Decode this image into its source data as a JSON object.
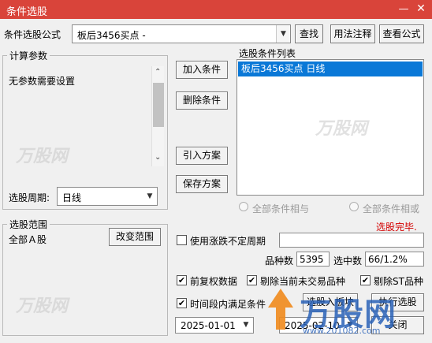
{
  "window": {
    "title": "条件选股"
  },
  "header": {
    "formula_label": "条件选股公式",
    "formula_value": "板后3456买点  -",
    "find_button": "查找",
    "usage_button": "用法注释",
    "view_formula_button": "查看公式"
  },
  "params": {
    "group_label": "计算参数",
    "no_params_text": "无参数需要设置",
    "period_label": "选股周期:",
    "period_value": "日线"
  },
  "actions": {
    "add_condition": "加入条件",
    "delete_condition": "删除条件",
    "import_scheme": "引入方案",
    "save_scheme": "保存方案"
  },
  "conditions": {
    "label": "选股条件列表",
    "items": [
      "板后3456买点  日线"
    ]
  },
  "logic": {
    "all_and": "全部条件相与",
    "all_or": "全部条件相或"
  },
  "status": {
    "text": "选股完毕.",
    "color": "#d40000"
  },
  "range": {
    "group_label": "选股范围",
    "value": "全部Ａ股",
    "change_button": "改变范围"
  },
  "options": {
    "use_limit_period": "使用涨跌不定周期",
    "adjusted_data": "前复权数据",
    "exclude_untraded": "剔除当前未交易品种",
    "exclude_st": "剔除ST品种",
    "time_range": "时间段内满足条件"
  },
  "stats": {
    "count_label": "品种数",
    "count_value": "5395",
    "selected_label": "选中数",
    "selected_value": "66/1.2%"
  },
  "dates": {
    "start": "2025-01-01",
    "end": "2025-02-10"
  },
  "bottom": {
    "select_button": "选股入板块",
    "run_button": "执行选股",
    "close_button": "关闭"
  },
  "watermark": {
    "brand": "万股网",
    "url": "www.201082.com"
  },
  "colors": {
    "titlebar": "#d9443a",
    "selection": "#0a78d7"
  }
}
